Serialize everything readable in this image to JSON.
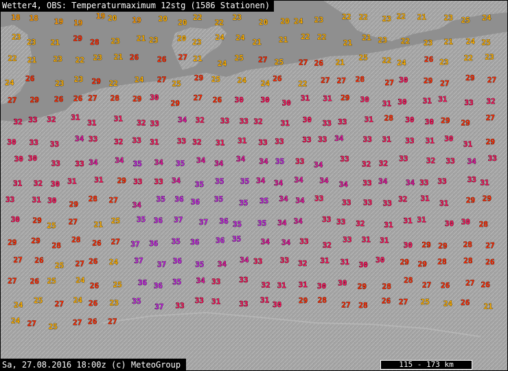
{
  "header": {
    "title": "Wetter4, OBS: Temperaturmaximum 12stg (1586 Stationen)"
  },
  "footer": {
    "timestamp": "Sa, 27.08.2016 18:00z (c) MeteoGroup",
    "scale_label": "115 - 173 km"
  },
  "colors": {
    "sea": "#8c8c8c",
    "land": "#9e9e9e",
    "t18_19": "#ff9a00",
    "t20_25": "#ffb000",
    "t26_29": "#ff2a00",
    "t30_33": "#ff0f5a",
    "t34": "#e0139a",
    "t35_plus": "#c21fe0"
  },
  "stations": [
    {
      "t": "18"
    },
    {
      "t": "18"
    },
    {
      "t": "19"
    },
    {
      "t": "19"
    },
    {
      "t": "19"
    },
    {
      "t": "20"
    },
    {
      "t": "19"
    },
    {
      "t": "20"
    },
    {
      "t": "20"
    },
    {
      "t": "22"
    },
    {
      "t": "22"
    },
    {
      "t": "23"
    },
    {
      "t": "20"
    },
    {
      "t": "20"
    },
    {
      "t": "24"
    },
    {
      "t": "23"
    },
    {
      "t": "22"
    },
    {
      "t": "22"
    },
    {
      "t": "23"
    },
    {
      "t": "22"
    },
    {
      "t": "21"
    },
    {
      "t": "23"
    },
    {
      "t": "25"
    },
    {
      "t": "24"
    },
    {
      "t": "23"
    },
    {
      "t": "23"
    },
    {
      "t": "21"
    },
    {
      "t": "29"
    },
    {
      "t": "28"
    },
    {
      "t": "23"
    },
    {
      "t": "21"
    },
    {
      "t": "23"
    },
    {
      "t": "20"
    },
    {
      "t": "23"
    },
    {
      "t": "24"
    },
    {
      "t": "24"
    },
    {
      "t": "21"
    },
    {
      "t": "21"
    },
    {
      "t": "22"
    },
    {
      "t": "22"
    },
    {
      "t": "21"
    },
    {
      "t": "21"
    },
    {
      "t": "23"
    },
    {
      "t": "22"
    },
    {
      "t": "23"
    },
    {
      "t": "21"
    },
    {
      "t": "24"
    },
    {
      "t": "25"
    },
    {
      "t": "22"
    },
    {
      "t": "21"
    },
    {
      "t": "23"
    },
    {
      "t": "22"
    },
    {
      "t": "23"
    },
    {
      "t": "21"
    },
    {
      "t": "26"
    },
    {
      "t": "26"
    },
    {
      "t": "27"
    },
    {
      "t": "21"
    },
    {
      "t": "24"
    },
    {
      "t": "25"
    },
    {
      "t": "27"
    },
    {
      "t": "25"
    },
    {
      "t": "27"
    },
    {
      "t": "26"
    },
    {
      "t": "21"
    },
    {
      "t": "25"
    },
    {
      "t": "22"
    },
    {
      "t": "24"
    },
    {
      "t": "26"
    },
    {
      "t": "23"
    },
    {
      "t": "22"
    },
    {
      "t": "23"
    },
    {
      "t": "24"
    },
    {
      "t": "26"
    },
    {
      "t": "23"
    },
    {
      "t": "23"
    },
    {
      "t": "29"
    },
    {
      "t": "22"
    },
    {
      "t": "24"
    },
    {
      "t": "27"
    },
    {
      "t": "25"
    },
    {
      "t": "29"
    },
    {
      "t": "25"
    },
    {
      "t": "24"
    },
    {
      "t": "24"
    },
    {
      "t": "26"
    },
    {
      "t": "22"
    },
    {
      "t": "27"
    },
    {
      "t": "27"
    },
    {
      "t": "28"
    },
    {
      "t": "27"
    },
    {
      "t": "30"
    },
    {
      "t": "29"
    },
    {
      "t": "27"
    },
    {
      "t": "29"
    },
    {
      "t": "27"
    },
    {
      "t": "27"
    },
    {
      "t": "29"
    },
    {
      "t": "26"
    },
    {
      "t": "26"
    },
    {
      "t": "27"
    },
    {
      "t": "28"
    },
    {
      "t": "29"
    },
    {
      "t": "30"
    },
    {
      "t": "29"
    },
    {
      "t": "27"
    },
    {
      "t": "26"
    },
    {
      "t": "30"
    },
    {
      "t": "30"
    },
    {
      "t": "30"
    },
    {
      "t": "31"
    },
    {
      "t": "31"
    },
    {
      "t": "29"
    },
    {
      "t": "30"
    },
    {
      "t": "31"
    },
    {
      "t": "30"
    },
    {
      "t": "31"
    },
    {
      "t": "31"
    },
    {
      "t": "33"
    },
    {
      "t": "32"
    },
    {
      "t": "32"
    },
    {
      "t": "33"
    },
    {
      "t": "32"
    },
    {
      "t": "31"
    },
    {
      "t": "31"
    },
    {
      "t": "31"
    },
    {
      "t": "32"
    },
    {
      "t": "33"
    },
    {
      "t": "34"
    },
    {
      "t": "32"
    },
    {
      "t": "33"
    },
    {
      "t": "33"
    },
    {
      "t": "32"
    },
    {
      "t": "31"
    },
    {
      "t": "30"
    },
    {
      "t": "33"
    },
    {
      "t": "33"
    },
    {
      "t": "31"
    },
    {
      "t": "28"
    },
    {
      "t": "30"
    },
    {
      "t": "30"
    },
    {
      "t": "29"
    },
    {
      "t": "29"
    },
    {
      "t": "27"
    },
    {
      "t": "30"
    },
    {
      "t": "33"
    },
    {
      "t": "33"
    },
    {
      "t": "34"
    },
    {
      "t": "33"
    },
    {
      "t": "32"
    },
    {
      "t": "33"
    },
    {
      "t": "31"
    },
    {
      "t": "33"
    },
    {
      "t": "32"
    },
    {
      "t": "31"
    },
    {
      "t": "31"
    },
    {
      "t": "33"
    },
    {
      "t": "33"
    },
    {
      "t": "33"
    },
    {
      "t": "33"
    },
    {
      "t": "34"
    },
    {
      "t": "33"
    },
    {
      "t": "31"
    },
    {
      "t": "33"
    },
    {
      "t": "31"
    },
    {
      "t": "30"
    },
    {
      "t": "31"
    },
    {
      "t": "29"
    },
    {
      "t": "30"
    },
    {
      "t": "30"
    },
    {
      "t": "33"
    },
    {
      "t": "33"
    },
    {
      "t": "34"
    },
    {
      "t": "34"
    },
    {
      "t": "35"
    },
    {
      "t": "34"
    },
    {
      "t": "35"
    },
    {
      "t": "34"
    },
    {
      "t": "34"
    },
    {
      "t": "34"
    },
    {
      "t": "34"
    },
    {
      "t": "35"
    },
    {
      "t": "33"
    },
    {
      "t": "34"
    },
    {
      "t": "33"
    },
    {
      "t": "32"
    },
    {
      "t": "32"
    },
    {
      "t": "33"
    },
    {
      "t": "32"
    },
    {
      "t": "33"
    },
    {
      "t": "34"
    },
    {
      "t": "33"
    },
    {
      "t": "31"
    },
    {
      "t": "32"
    },
    {
      "t": "30"
    },
    {
      "t": "31"
    },
    {
      "t": "31"
    },
    {
      "t": "29"
    },
    {
      "t": "33"
    },
    {
      "t": "33"
    },
    {
      "t": "34"
    },
    {
      "t": "35"
    },
    {
      "t": "35"
    },
    {
      "t": "35"
    },
    {
      "t": "34"
    },
    {
      "t": "34"
    },
    {
      "t": "34"
    },
    {
      "t": "34"
    },
    {
      "t": "34"
    },
    {
      "t": "33"
    },
    {
      "t": "34"
    },
    {
      "t": "34"
    },
    {
      "t": "33"
    },
    {
      "t": "33"
    },
    {
      "t": "33"
    },
    {
      "t": "31"
    },
    {
      "t": "33"
    },
    {
      "t": "31"
    },
    {
      "t": "30"
    },
    {
      "t": "29"
    },
    {
      "t": "28"
    },
    {
      "t": "27"
    },
    {
      "t": "34"
    },
    {
      "t": "35"
    },
    {
      "t": "36"
    },
    {
      "t": "36"
    },
    {
      "t": "35"
    },
    {
      "t": "35"
    },
    {
      "t": "35"
    },
    {
      "t": "34"
    },
    {
      "t": "34"
    },
    {
      "t": "33"
    },
    {
      "t": "33"
    },
    {
      "t": "33"
    },
    {
      "t": "33"
    },
    {
      "t": "32"
    },
    {
      "t": "31"
    },
    {
      "t": "31"
    },
    {
      "t": "29"
    },
    {
      "t": "29"
    },
    {
      "t": "30"
    },
    {
      "t": "29"
    },
    {
      "t": "25"
    },
    {
      "t": "27"
    },
    {
      "t": "21"
    },
    {
      "t": "25"
    },
    {
      "t": "35"
    },
    {
      "t": "36"
    },
    {
      "t": "37"
    },
    {
      "t": "37"
    },
    {
      "t": "36"
    },
    {
      "t": "35"
    },
    {
      "t": "35"
    },
    {
      "t": "34"
    },
    {
      "t": "34"
    },
    {
      "t": "33"
    },
    {
      "t": "33"
    },
    {
      "t": "32"
    },
    {
      "t": "31"
    },
    {
      "t": "31"
    },
    {
      "t": "31"
    },
    {
      "t": "30"
    },
    {
      "t": "30"
    },
    {
      "t": "28"
    },
    {
      "t": "29"
    },
    {
      "t": "29"
    },
    {
      "t": "28"
    },
    {
      "t": "28"
    },
    {
      "t": "26"
    },
    {
      "t": "27"
    },
    {
      "t": "37"
    },
    {
      "t": "36"
    },
    {
      "t": "35"
    },
    {
      "t": "36"
    },
    {
      "t": "36"
    },
    {
      "t": "35"
    },
    {
      "t": "34"
    },
    {
      "t": "34"
    },
    {
      "t": "33"
    },
    {
      "t": "32"
    },
    {
      "t": "33"
    },
    {
      "t": "31"
    },
    {
      "t": "31"
    },
    {
      "t": "30"
    },
    {
      "t": "29"
    },
    {
      "t": "29"
    },
    {
      "t": "28"
    },
    {
      "t": "27"
    },
    {
      "t": "27"
    },
    {
      "t": "26"
    },
    {
      "t": "25"
    },
    {
      "t": "27"
    },
    {
      "t": "26"
    },
    {
      "t": "24"
    },
    {
      "t": "37"
    },
    {
      "t": "37"
    },
    {
      "t": "36"
    },
    {
      "t": "35"
    },
    {
      "t": "34"
    },
    {
      "t": "34"
    },
    {
      "t": "33"
    },
    {
      "t": "33"
    },
    {
      "t": "32"
    },
    {
      "t": "31"
    },
    {
      "t": "31"
    },
    {
      "t": "30"
    },
    {
      "t": "30"
    },
    {
      "t": "29"
    },
    {
      "t": "29"
    },
    {
      "t": "28"
    },
    {
      "t": "28"
    },
    {
      "t": "26"
    },
    {
      "t": "27"
    },
    {
      "t": "26"
    },
    {
      "t": "25"
    },
    {
      "t": "24"
    },
    {
      "t": "26"
    },
    {
      "t": "25"
    },
    {
      "t": "36"
    },
    {
      "t": "36"
    },
    {
      "t": "35"
    },
    {
      "t": "34"
    },
    {
      "t": "33"
    },
    {
      "t": "33"
    },
    {
      "t": "32"
    },
    {
      "t": "31"
    },
    {
      "t": "31"
    },
    {
      "t": "30"
    },
    {
      "t": "30"
    },
    {
      "t": "29"
    },
    {
      "t": "28"
    },
    {
      "t": "28"
    },
    {
      "t": "27"
    },
    {
      "t": "26"
    },
    {
      "t": "27"
    },
    {
      "t": "26"
    },
    {
      "t": "24"
    },
    {
      "t": "25"
    },
    {
      "t": "27"
    },
    {
      "t": "24"
    },
    {
      "t": "26"
    },
    {
      "t": "23"
    },
    {
      "t": "35"
    },
    {
      "t": "37"
    },
    {
      "t": "33"
    },
    {
      "t": "33"
    },
    {
      "t": "31"
    },
    {
      "t": "33"
    },
    {
      "t": "31"
    },
    {
      "t": "30"
    },
    {
      "t": "29"
    },
    {
      "t": "28"
    },
    {
      "t": "27"
    },
    {
      "t": "28"
    },
    {
      "t": "26"
    },
    {
      "t": "27"
    },
    {
      "t": "25"
    },
    {
      "t": "24"
    },
    {
      "t": "26"
    },
    {
      "t": "21"
    },
    {
      "t": "24"
    },
    {
      "t": "27"
    },
    {
      "t": "25"
    },
    {
      "t": "27"
    },
    {
      "t": "26"
    },
    {
      "t": "27"
    }
  ]
}
